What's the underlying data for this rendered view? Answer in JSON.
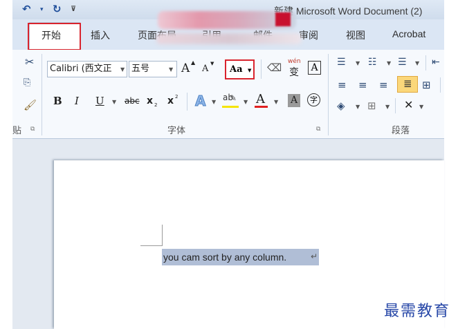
{
  "titlebar": {
    "title": "新建 Microsoft Word Document (2)",
    "undo_icon": "undo-icon",
    "redo_icon": "redo-icon",
    "customize_icon": "customize-quick-access-icon"
  },
  "tabs": [
    {
      "label": "开始",
      "active": true
    },
    {
      "label": "插入"
    },
    {
      "label": "页面布局"
    },
    {
      "label": "引用"
    },
    {
      "label": "邮件"
    },
    {
      "label": "审阅"
    },
    {
      "label": "视图"
    },
    {
      "label": "Acrobat"
    }
  ],
  "font_group": {
    "label": "字体",
    "font_name": "Calibri (西文正",
    "font_size": "五号",
    "grow_label": "A",
    "shrink_label": "A",
    "change_case_label": "Aa",
    "clear_format_icon": "clear-formatting-icon",
    "phonetic_label": "wén",
    "phonetic_char": "变",
    "char_border_label": "A",
    "bold": "B",
    "italic": "I",
    "underline": "U",
    "strike": "abc",
    "subscript": "x",
    "superscript": "x",
    "sub_mark": "2",
    "sup_mark": "2",
    "text_effect": "A",
    "highlight_label": "ab",
    "font_color_label": "A",
    "char_shading_label": "A",
    "enclose_char": "字",
    "highlight_color": "#f5e400",
    "font_color": "#e02020"
  },
  "paragraph_group": {
    "label": "段落"
  },
  "clipboard_group": {
    "label": "贴"
  },
  "document": {
    "text": "you cam sort by any column.",
    "para_mark": "↵"
  },
  "watermark": "最需教育",
  "colors": {
    "highlight_box": "#d9232d",
    "selection": "#b0bed6",
    "watermark": "#2848a8"
  }
}
